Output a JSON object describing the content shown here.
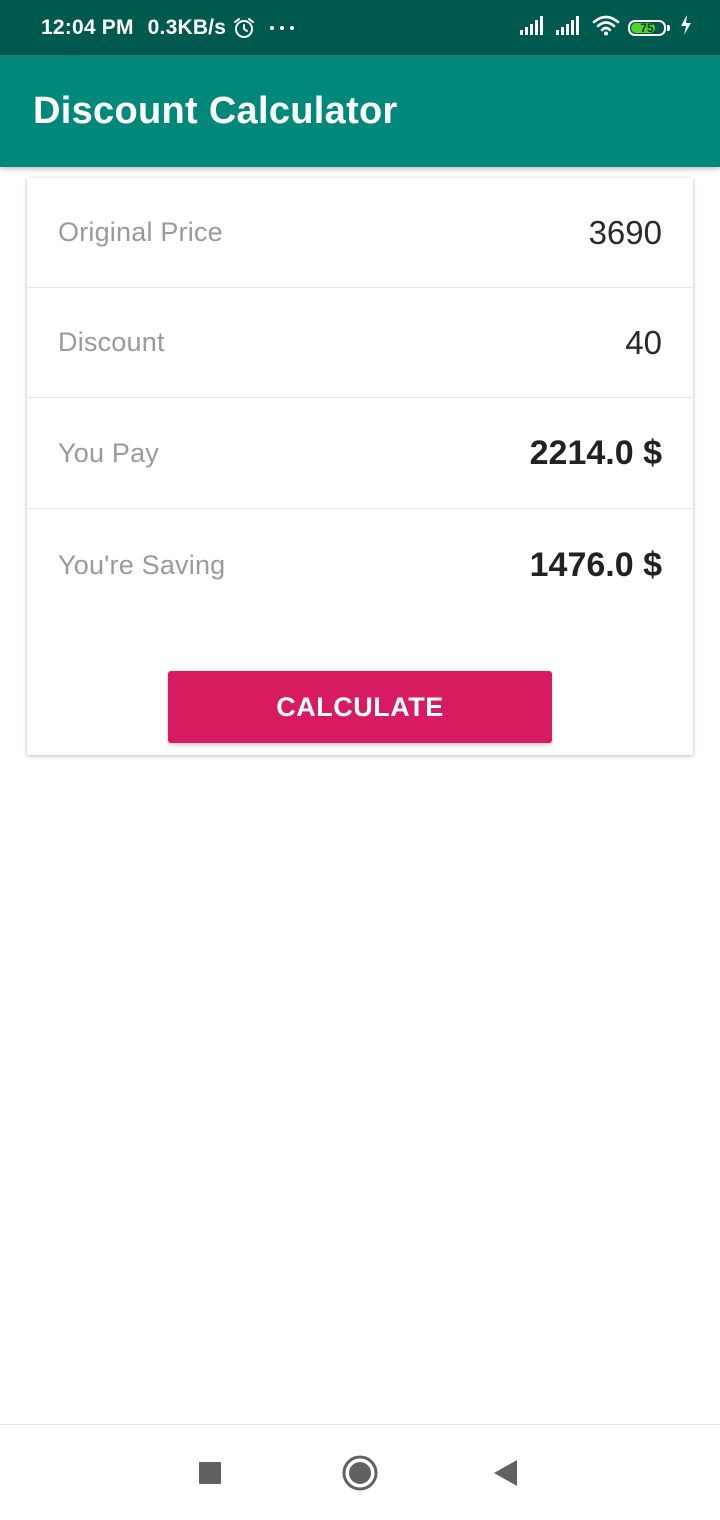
{
  "status_bar": {
    "time": "12:04 PM",
    "net_speed": "0.3KB/s",
    "battery_level": "75",
    "battery_fraction": 0.75,
    "icons": [
      "alarm-icon",
      "more-dots-icon",
      "signal-icon",
      "signal-icon",
      "wifi-icon",
      "battery-icon",
      "charging-icon"
    ]
  },
  "app_bar": {
    "title": "Discount Calculator"
  },
  "rows": [
    {
      "label": "Original Price",
      "value": "3690"
    },
    {
      "label": "Discount",
      "value": "40"
    },
    {
      "label": "You Pay",
      "value": "2214.0 $"
    },
    {
      "label": "You're Saving",
      "value": "1476.0 $"
    }
  ],
  "calculate_button": {
    "label": "CALCULATE"
  },
  "nav_bar": {
    "icons": [
      "recents-square-icon",
      "home-circle-icon",
      "back-triangle-icon"
    ]
  },
  "colors": {
    "status_bar": "#00594e",
    "app_bar": "#00897b",
    "accent_button": "#d81b60",
    "battery_fill": "#54d12a"
  }
}
